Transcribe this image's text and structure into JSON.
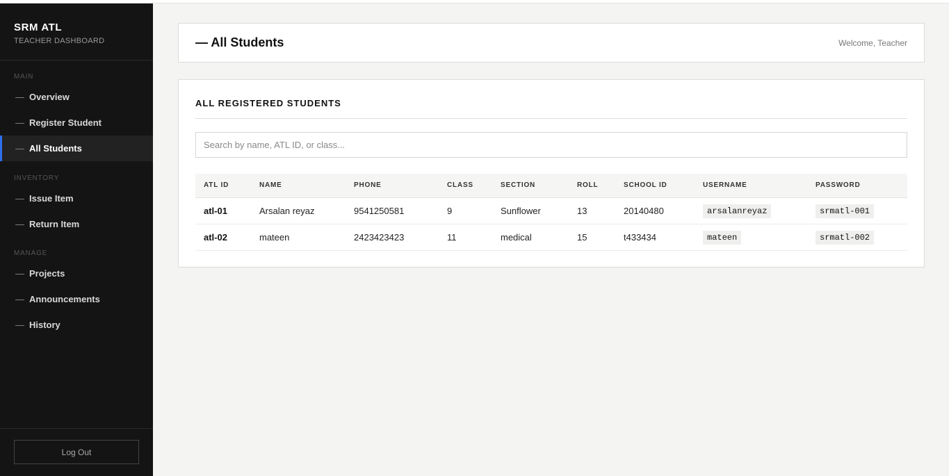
{
  "sidebar": {
    "brand_title": "SRM ATL",
    "brand_subtitle": "TEACHER DASHBOARD",
    "sections": {
      "main": "MAIN",
      "inventory": "INVENTORY",
      "manage": "MANAGE"
    },
    "items": [
      {
        "label": "Overview"
      },
      {
        "label": "Register Student"
      },
      {
        "label": "All Students",
        "active": true
      },
      {
        "label": "Issue Item"
      },
      {
        "label": "Return Item"
      },
      {
        "label": "Projects"
      },
      {
        "label": "Announcements"
      },
      {
        "label": "History"
      }
    ],
    "dash": "—",
    "logout_label": "Log Out"
  },
  "header": {
    "title": "— All Students",
    "welcome": "Welcome, Teacher"
  },
  "students": {
    "heading": "ALL REGISTERED STUDENTS",
    "search_placeholder": "Search by name, ATL ID, or class...",
    "columns": [
      "ATL ID",
      "NAME",
      "PHONE",
      "CLASS",
      "SECTION",
      "ROLL",
      "SCHOOL ID",
      "USERNAME",
      "PASSWORD"
    ],
    "rows": [
      {
        "atl_id": "atl-01",
        "name": "Arsalan reyaz",
        "phone": "9541250581",
        "class": "9",
        "section": "Sunflower",
        "roll": "13",
        "school_id": "20140480",
        "username": "arsalanreyaz",
        "password": "srmatl-001"
      },
      {
        "atl_id": "atl-02",
        "name": "mateen",
        "phone": "2423423423",
        "class": "11",
        "section": "medical",
        "roll": "15",
        "school_id": "t433434",
        "username": "mateen",
        "password": "srmatl-002"
      }
    ]
  },
  "colors": {
    "sidebar_bg": "#141414",
    "accent": "#2f6fed",
    "page_bg": "#f4f4f2"
  }
}
